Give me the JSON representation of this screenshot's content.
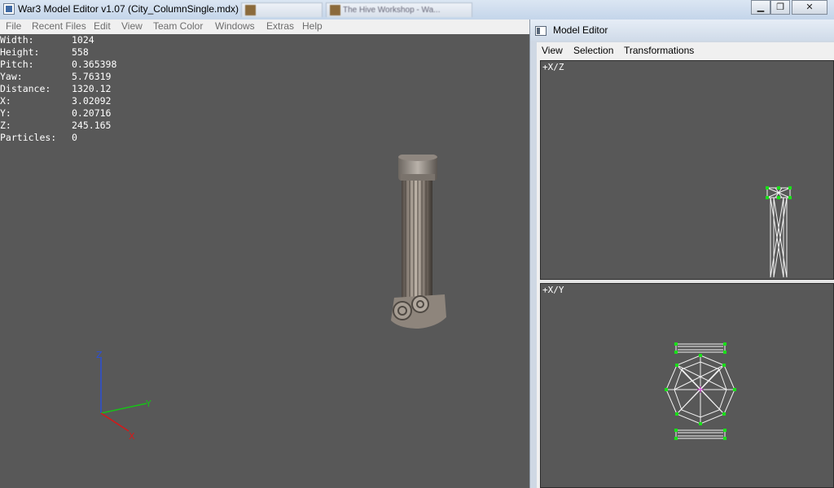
{
  "window": {
    "title": "War3 Model Editor v1.07 (City_ColumnSingle.mdx) *",
    "background_tabs": [
      "",
      "The Hive Workshop - Wa..."
    ],
    "controls": {
      "minimize": "▁",
      "maximize": "❐",
      "close": "✕"
    }
  },
  "menu": [
    "File",
    "Recent Files",
    "Edit",
    "View",
    "Team Color",
    "Windows",
    "Extras",
    "Help"
  ],
  "stats": [
    {
      "label": "Width:",
      "value": "1024"
    },
    {
      "label": "Height:",
      "value": "558"
    },
    {
      "label": "Pitch:",
      "value": "0.365398"
    },
    {
      "label": "Yaw:",
      "value": "5.76319"
    },
    {
      "label": "Distance:",
      "value": "1320.12"
    },
    {
      "label": "X:",
      "value": "3.02092"
    },
    {
      "label": "Y:",
      "value": "0.20716"
    },
    {
      "label": "Z:",
      "value": "245.165"
    },
    {
      "label": "Particles:",
      "value": "0"
    }
  ],
  "axes": {
    "z": "Z",
    "y": "Y",
    "x": "X"
  },
  "colors": {
    "viewport_bg": "#585858",
    "axis_z": "#2b4fd6",
    "axis_y": "#17c317",
    "axis_x": "#d81818",
    "vertex": "#19e019"
  },
  "model_editor": {
    "title": "Model Editor",
    "menu": [
      "View",
      "Selection",
      "Transformations"
    ],
    "panes": [
      {
        "label": "+X/Z"
      },
      {
        "label": "+X/Y"
      }
    ]
  }
}
